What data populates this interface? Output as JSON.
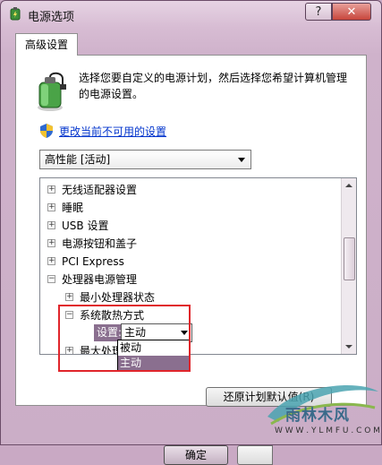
{
  "window": {
    "title": "电源选项",
    "help_button": "?",
    "close_button": "✕"
  },
  "tab": {
    "label": "高级设置"
  },
  "description": "选择您要自定义的电源计划，然后选择您希望计算机管理的电源设置。",
  "change_link": "更改当前不可用的设置",
  "plan_select": {
    "value": "高性能 [活动]"
  },
  "tree": {
    "items": [
      {
        "expander": "+",
        "label": "无线适配器设置"
      },
      {
        "expander": "+",
        "label": "睡眠"
      },
      {
        "expander": "+",
        "label": "USB 设置"
      },
      {
        "expander": "+",
        "label": "电源按钮和盖子"
      },
      {
        "expander": "+",
        "label": "PCI Express"
      },
      {
        "expander": "−",
        "label": "处理器电源管理"
      },
      {
        "expander": "+",
        "label": "最小处理器状态"
      },
      {
        "expander": "−",
        "label": "系统散热方式"
      },
      {
        "expander": "+",
        "label": "最大处理"
      }
    ],
    "setting_label": "设置:",
    "setting_value": "主动"
  },
  "dropdown": {
    "options": [
      {
        "label": "被动",
        "selected": false
      },
      {
        "label": "主动",
        "selected": true
      }
    ]
  },
  "restore_button": "还原计划默认值(R)",
  "ok_button": "确定",
  "watermark": {
    "name": "雨林木风",
    "url": "W W W . Y L M F U . C O M"
  },
  "colors": {
    "accent": "#8a6f8f",
    "link": "#0033cc",
    "highlight_box": "#e0252b"
  }
}
